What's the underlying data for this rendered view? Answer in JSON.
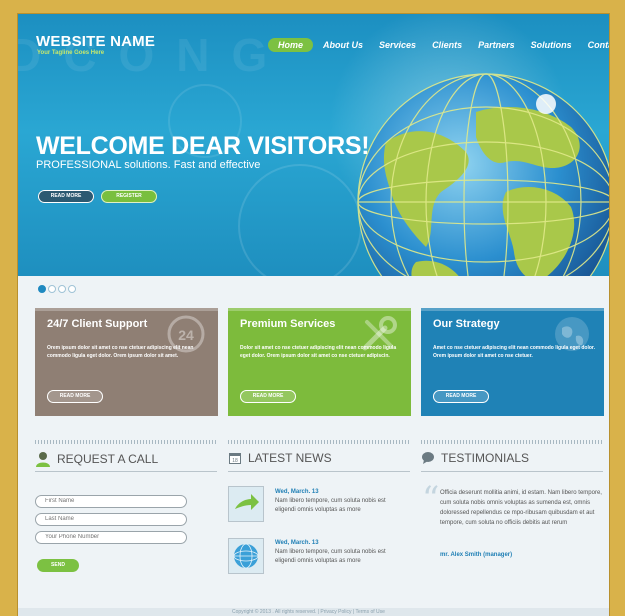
{
  "header": {
    "site_name": "WEBSITE NAME",
    "tagline": "Your Tagline Goes Here",
    "nav": [
      "Home",
      "About Us",
      "Services",
      "Clients",
      "Partners",
      "Solutions",
      "Contacts"
    ]
  },
  "hero": {
    "title": "WELCOME DEAR VISITORS!",
    "subtitle": "PROFESSIONAL solutions. Fast and effective",
    "read_more": "READ MORE",
    "register": "REGISTER"
  },
  "slider": {
    "active_index": 0,
    "count": 4
  },
  "features": [
    {
      "title": "24/7 Client Support",
      "text": "Orem ipsum dolor sit amet co nse ctetuer adipiscing elit nean commodo ligula eget dolor. Orem ipsum dolor sit amet.",
      "button": "READ MORE",
      "icon": "support-24-icon"
    },
    {
      "title": "Premium Services",
      "text": "Dolor sit amet co nse ctetuer adipiscing elit nean commodo ligula eget dolor. Orem ipsum dolor sit amet co nse ctetuer adipiscin.",
      "button": "READ MORE",
      "icon": "wrench-screwdriver-icon"
    },
    {
      "title": "Our Strategy",
      "text": "Amet co nse ctetuer adipiscing elit nean commodo ligula eget dolor. Orem ipsum dolor sit amet co nse ctetuer.",
      "button": "READ MORE",
      "icon": "globe-icon"
    }
  ],
  "request_call": {
    "title": "REQUEST A CALL",
    "first_name_placeholder": "First Name",
    "last_name_placeholder": "Last Name",
    "phone_placeholder": "Your Phone Number",
    "send": "SEND"
  },
  "news": {
    "title": "LATEST NEWS",
    "items": [
      {
        "date": "Wed, March. 13",
        "text": "Nam libero tempore, cum soluta nobis est eligendi omnis voluptas as more"
      },
      {
        "date": "Wed, March. 13",
        "text": "Nam libero tempore, cum soluta nobis est eligendi omnis voluptas as more"
      }
    ]
  },
  "testimonials": {
    "title": "TESTIMONIALS",
    "text": "Officia deserunt mollitia animi, id estam. Nam libero tempore, cum soluta nobis omnis voluptas as sumenda est, omnis doloressed repellendus ce mpo-ribusam quibusdam et aut tempore, cum soluta no officiis debitis aut rerum",
    "author": "mr. Alex Smith (manager)"
  },
  "footer": {
    "text": "Copyright © 2013 . All rights reserved.   |   Privacy Policy   |   Terms of Use"
  },
  "watermark": "DCONG",
  "colors": {
    "brand_blue": "#1f89c0",
    "green": "#7cc142",
    "brown": "#8f7f74",
    "frame": "#d9b24a"
  }
}
